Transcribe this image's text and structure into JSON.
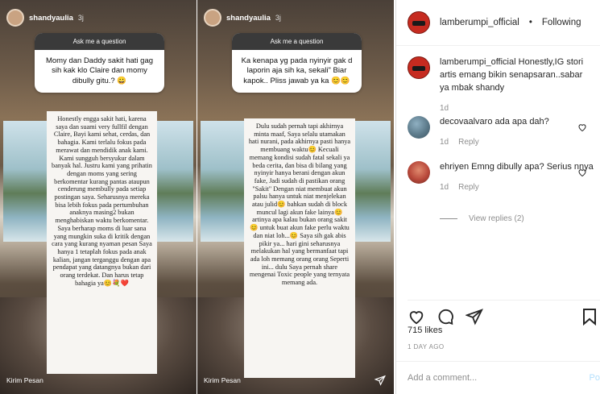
{
  "stories": [
    {
      "username": "shandyaulia",
      "time": "3j",
      "ask_title": "Ask me a question",
      "question": "Momy dan Daddy sakit hati gag sih kak klo Claire dan momy dibully gitu.? 😀",
      "answer": "Honestly engga sakit hati, karena saya dan suami very fullfil dengan Claire, Bayi kami sehat, cerdas, dan bahagia. Kami terlalu fokus pada merawat dan mendidik anak kami. Kami sungguh bersyukur dalam banyak hal. Justru kami yang prihatin dengan moms yang sering berkomentar kurang pantas ataupun cenderung membully pada setiap postingan saya. Seharusnya mereka bisa lebih fokus pada pertumbuhan anaknya masing2 bukan menghabiskan waktu berkomentar. Saya berharap moms di luar sana yang mungkin suka di kritik dengan cara yang kurang nyaman pesan Saya hanya 1 tetaplah fokus pada anak kalian, jangan terganggu dengan apa pendapat yang datangnya bukan dari orang terdekat. Dan harus tetap bahagia ya😊💐❤️",
      "reply_label": "Kirim Pesan"
    },
    {
      "username": "shandyaulia",
      "time": "3j",
      "ask_title": "Ask me a question",
      "question": "Ka kenapa yg pada nyinyir gak d laporin aja sih ka, sekali\" Biar kapok.. Pliss jawab ya ka 😊😊",
      "answer": "Dulu sudah pernah tapi akhirnya minta maaf, Saya selalu utamakan hati nurani, pada akhirnya pasti hanya membuang waktu😊 Kecuali memang kondisi sudah fatal sekali ya beda cerita, dan bisa di bilang yang nyinyir hanya berani dengan akun fake, Jadi sudah di pastikan orang \"Sakit\" Dengan niat membuat akun palsu hanya untuk niat menjelekan atau julid😊 bahkan sudah di block muncul lagi akun fake lainya😊 artinya apa kalau bukan orang sakit😊 untuk buat akun fake perlu waktu dan niat loh...😊 Saya sih gak abis pikir ya... hari gini seharusnya melakukan hal yang bermanfaat tapi ada loh memang orang orang Seperti ini... dulu Saya pernah share mengenai Toxic people yang ternyata memang ada.",
      "reply_label": "Kirim Pesan"
    }
  ],
  "post": {
    "header": {
      "handle": "lamberumpi_official",
      "separator": "•",
      "follow_label": "Following"
    },
    "caption": {
      "user": "lamberumpi_official",
      "text": "Honestly,IG stori artis emang bikin senapsaran..sabar ya mbak shandy",
      "time": "1d"
    },
    "comments": [
      {
        "user": "decovaalvaro",
        "text": "ada apa dah?",
        "time": "1d",
        "reply_label": "Reply"
      },
      {
        "user": "ehriyen",
        "text": "Emng dibully apa? Serius nnya",
        "time": "1d",
        "reply_label": "Reply",
        "view_replies_label": "View replies (2)"
      }
    ],
    "likes": "715 likes",
    "date": "1 DAY AGO",
    "add_comment_placeholder": "Add a comment...",
    "post_label": "Po"
  },
  "icons": {
    "heart": "heart-icon",
    "comment": "comment-icon",
    "share": "share-icon",
    "save": "bookmark-icon",
    "send": "send-icon"
  },
  "colors": {
    "brand_red": "#c62b20",
    "muted_text": "#8e8e8e",
    "post_button": "#b2dffc"
  }
}
